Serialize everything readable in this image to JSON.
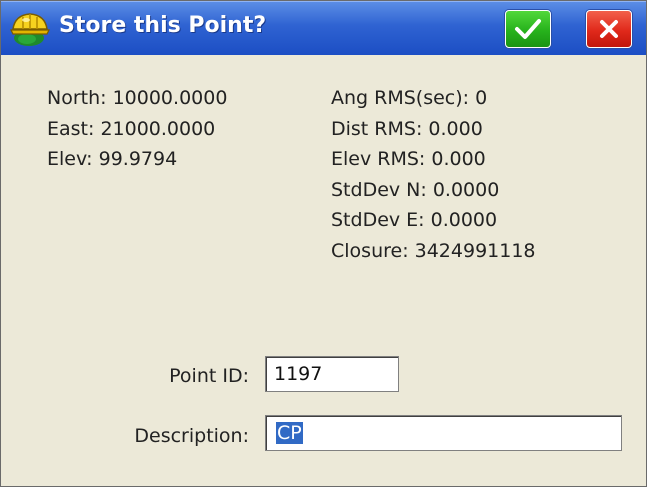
{
  "title_bar": {
    "title": "Store this Point?",
    "app_icon": "surveyor-hardhat-icon",
    "ok_icon": "checkmark-icon",
    "close_icon": "close-x-icon"
  },
  "point": {
    "north": "North: 10000.0000",
    "east": "East: 21000.0000",
    "elev": "Elev: 99.9794"
  },
  "stats": {
    "ang_rms": "Ang RMS(sec): 0",
    "dist_rms": "Dist RMS: 0.000",
    "elev_rms": "Elev RMS: 0.000",
    "stddev_n": "StdDev N: 0.0000",
    "stddev_e": "StdDev E: 0.0000",
    "closure": "Closure: 3424991118"
  },
  "form": {
    "point_id_label": "Point ID:",
    "point_id_value": "1197",
    "description_label": "Description:",
    "description_value": "CP"
  },
  "colors": {
    "titlebar": "#2f63d2",
    "ok_button": "#27b21c",
    "close_button": "#e0291b",
    "dialog_bg": "#ece9d8",
    "selection": "#316ac5"
  }
}
